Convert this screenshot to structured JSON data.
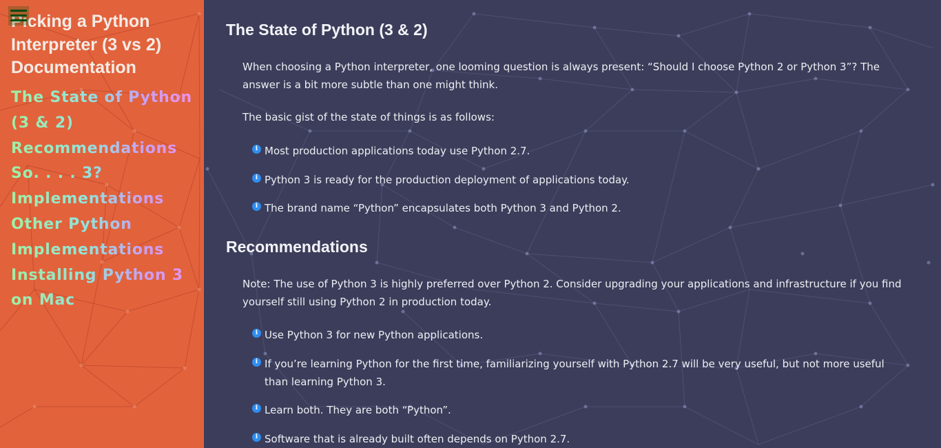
{
  "sidebar": {
    "title": "Picking a Python Interpreter (3 vs 2) Documentation",
    "toc": [
      "The State of Python (3 & 2)",
      "Recommendations",
      "So. . . . 3?",
      "Implementations",
      "Other Python Implementations",
      "Installing Python 3 on Mac"
    ]
  },
  "menu_icon": "hamburger-menu-icon",
  "bullet_icon": "info-icon",
  "colors": {
    "sidebar_bg": "#e2623c",
    "main_bg": "#3c3d5a",
    "bullet_icon": "#2f8ef0"
  },
  "main": {
    "section1": {
      "heading": "The State of Python (3 & 2)",
      "intro": "When choosing a Python interpreter, one looming question is always present: “Should I choose Python 2 or Python 3”? The answer is a bit more subtle than one might think.",
      "gist": "The basic gist of the state of things is as follows:",
      "bullets": [
        "Most production applications today use Python 2.7.",
        "Python 3 is ready for the production deployment of applications today.",
        "The brand name “Python” encapsulates both Python 3 and Python 2."
      ]
    },
    "section2": {
      "heading": "Recommendations",
      "note": "Note: The use of Python 3 is highly preferred over Python 2. Consider upgrading your applications and infrastructure if you find yourself still using Python 2 in production today.",
      "bullets": [
        "Use Python 3 for new Python applications.",
        "If you’re learning Python for the first time, familiarizing yourself with Python 2.7 will be very useful, but not more useful than learning Python 3.",
        "Learn both. They are both “Python”.",
        "Software that is already built often depends on Python 2.7."
      ]
    }
  }
}
